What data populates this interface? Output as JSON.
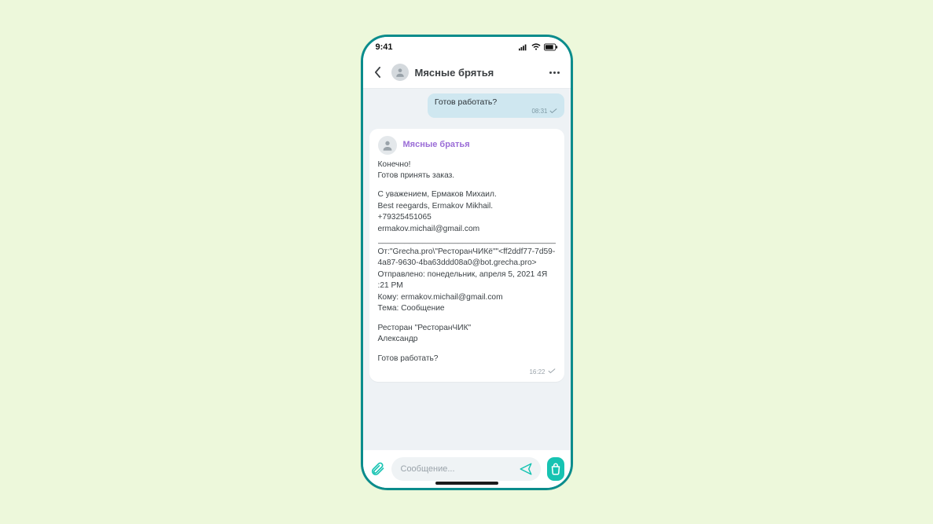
{
  "status": {
    "time": "9:41"
  },
  "header": {
    "title": "Мясные брятья"
  },
  "messages": {
    "out1": {
      "text": "Готов работать?",
      "time": "08:31"
    },
    "in1": {
      "sender": "Мясные братья",
      "l1": "Конечно!",
      "l2": "Готов принять заказ.",
      "l3": "С уважением, Ермаков Михаил.",
      "l4": "Best reegards, Ermakov Mikhail.",
      "l5": "+79325451065",
      "l6": "ermakov.michail@gmail.com",
      "divider": "________________________________________",
      "l7": "От:\"Grecha.pro\\\"РесторанЧИКё\"\"<ff2ddf77-7d59-4a87-9630-4ba63ddd08a0@bot.grecha.pro>",
      "l8": "Отправлено: понедельник, апреля 5, 2021 4Я :21 PM",
      "l9": "Кому: ermakov.michail@gmail.com",
      "l10": "Тема: Сообщение",
      "l11": "Ресторан \"РесторанЧИК\"",
      "l12": "Александр",
      "l13": "Готов работать?",
      "time": "16:22"
    }
  },
  "composer": {
    "placeholder": "Сообщение..."
  }
}
